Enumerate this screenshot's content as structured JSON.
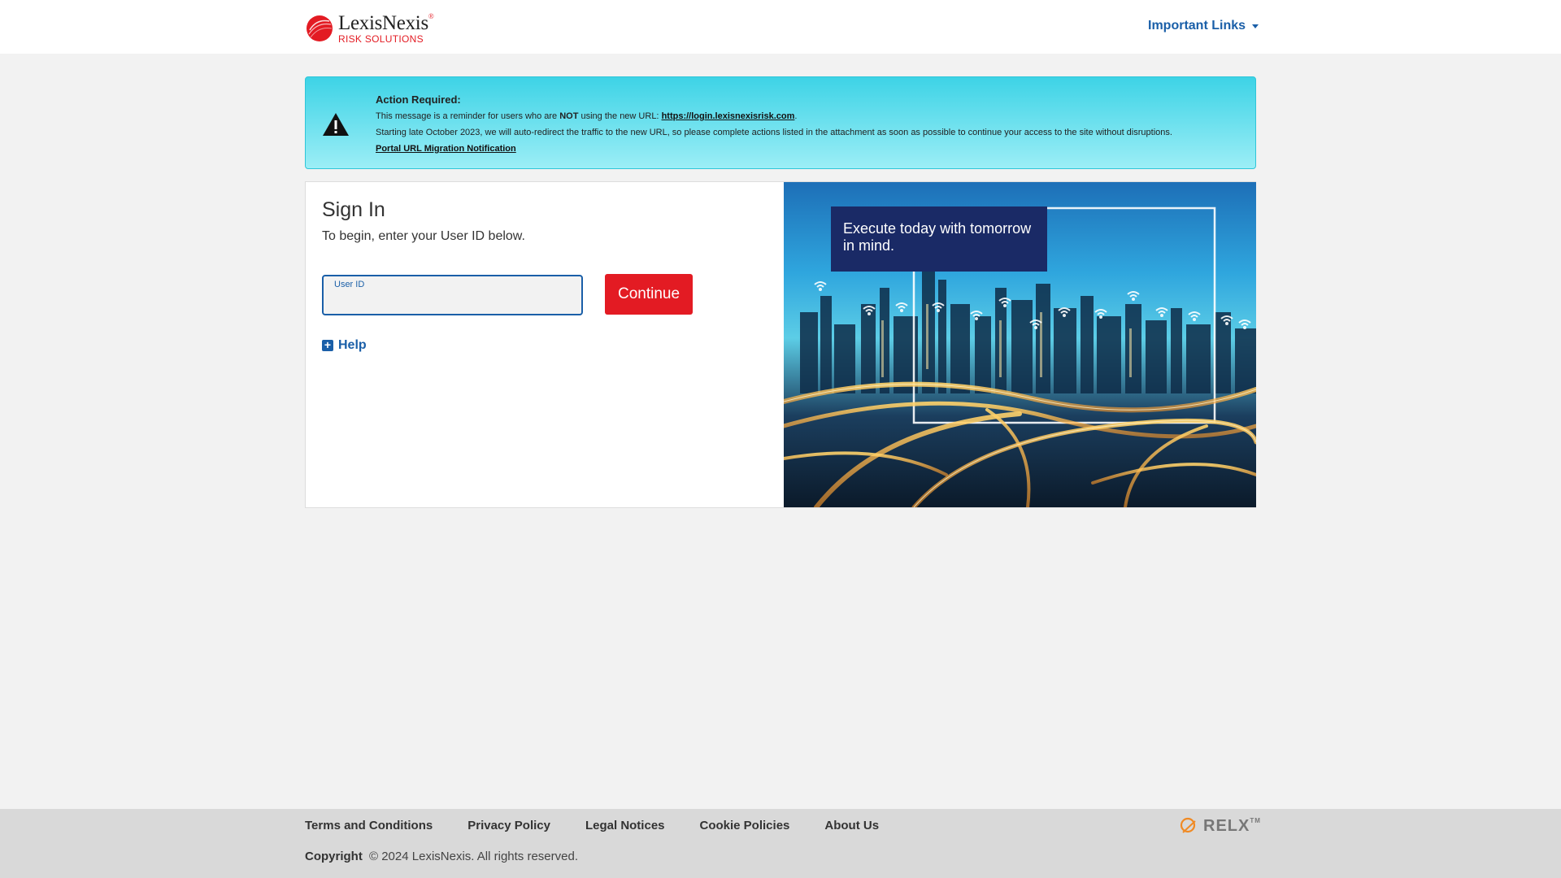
{
  "header": {
    "logo": {
      "name": "LexisNexis",
      "reg": "®",
      "sub": "RISK SOLUTIONS"
    },
    "important_links": "Important Links"
  },
  "alert": {
    "title": "Action Required:",
    "line1_pre": "This message is a reminder for users who are ",
    "line1_not": "NOT",
    "line1_mid": " using the new URL: ",
    "line1_url": "https://login.lexisnexisrisk.com",
    "line1_end": ".",
    "line2": "Starting late October 2023, we will auto-redirect the traffic to the new URL, so please complete actions listed in the attachment as soon as possible to continue your access to the site without disruptions.",
    "link": "Portal URL Migration Notification"
  },
  "signin": {
    "title": "Sign In",
    "subtitle": "To begin, enter your User ID below.",
    "userid_label": "User ID",
    "userid_value": "",
    "continue_label": "Continue",
    "help_label": "Help"
  },
  "hero": {
    "caption": "Execute today with tomorrow in mind."
  },
  "footer": {
    "links": [
      "Terms and Conditions",
      "Privacy Policy",
      "Legal Notices",
      "Cookie Policies",
      "About Us"
    ],
    "copyright_label": "Copyright",
    "copyright_text": "© 2024 LexisNexis. All rights reserved.",
    "relx": "RELX",
    "relx_tm": "TM"
  },
  "colors": {
    "brand_red": "#e31b23",
    "link_blue": "#1a5fa8",
    "alert_cyan": "#3dd3e6",
    "caption_navy": "#1a2a66"
  }
}
